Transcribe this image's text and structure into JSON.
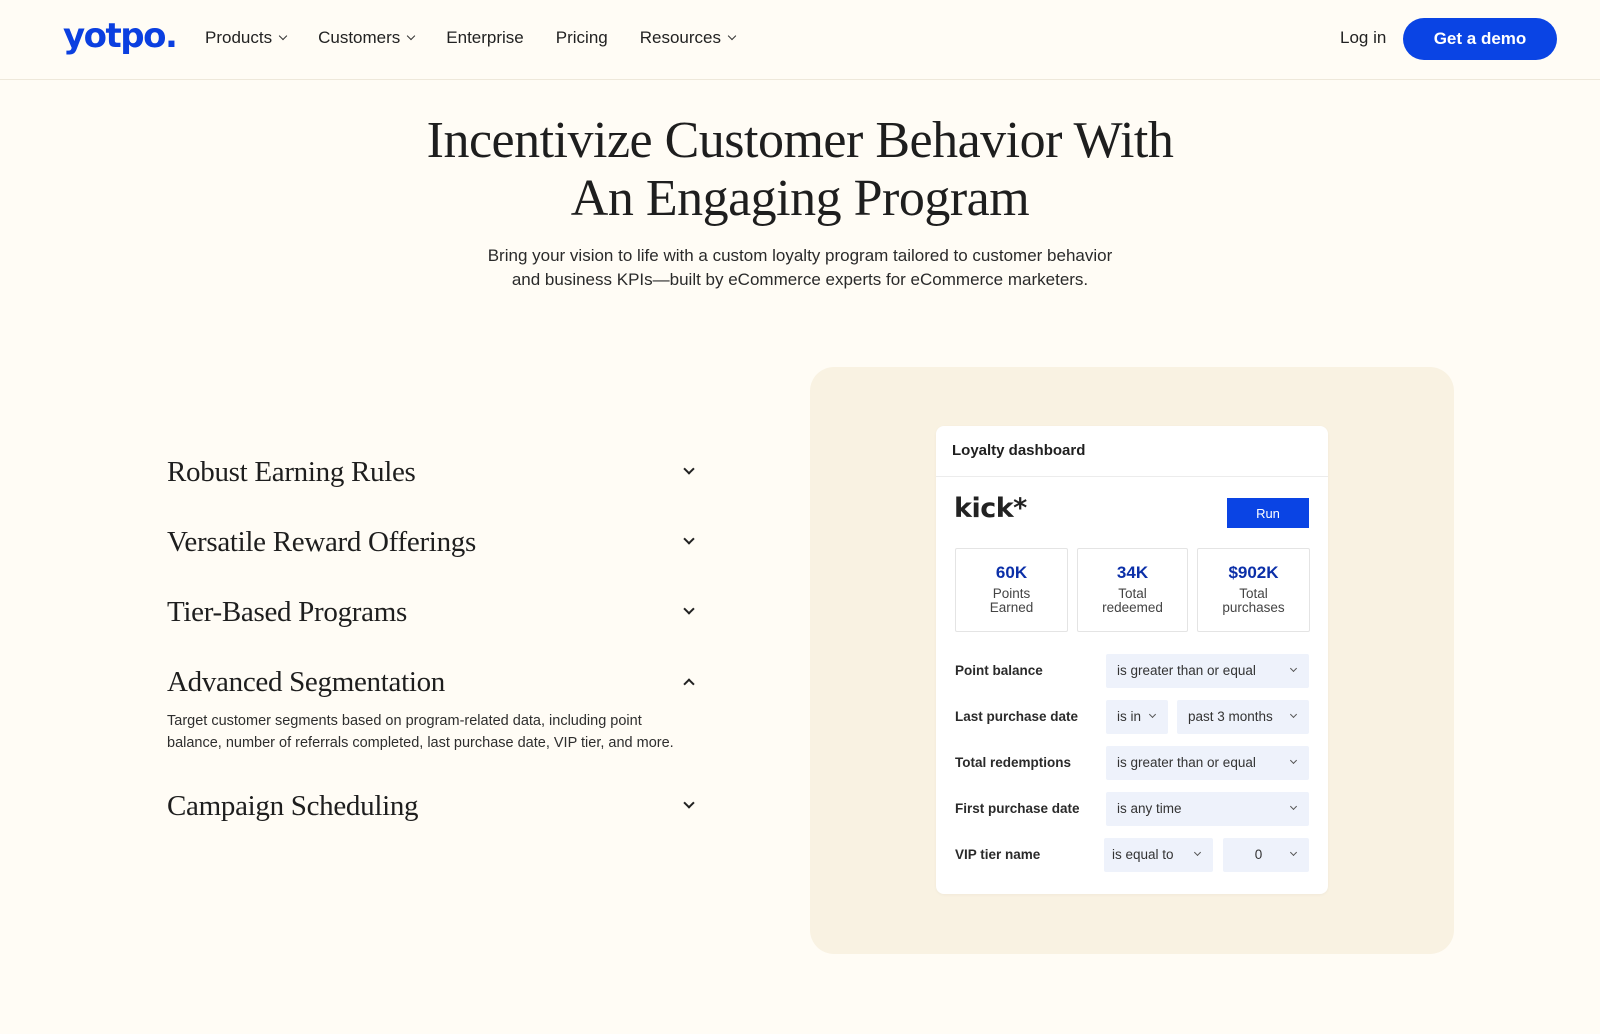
{
  "nav": {
    "logo": "yotpo.",
    "items": [
      {
        "label": "Products",
        "dropdown": true
      },
      {
        "label": "Customers",
        "dropdown": true
      },
      {
        "label": "Enterprise",
        "dropdown": false
      },
      {
        "label": "Pricing",
        "dropdown": false
      },
      {
        "label": "Resources",
        "dropdown": true
      }
    ],
    "login": "Log in",
    "cta": "Get a demo"
  },
  "hero": {
    "title_line1": "Incentivize Customer Behavior With",
    "title_line2": "An Engaging Program",
    "subtitle_line1": "Bring your vision to life with a custom loyalty program tailored to customer behavior",
    "subtitle_line2": "and business KPIs—built by eCommerce experts for eCommerce marketers."
  },
  "features": [
    {
      "title": "Robust Earning Rules",
      "expanded": false
    },
    {
      "title": "Versatile Reward Offerings",
      "expanded": false
    },
    {
      "title": "Tier-Based Programs",
      "expanded": false
    },
    {
      "title": "Advanced Segmentation",
      "expanded": true,
      "body": "Target customer segments based on program-related data, including point balance, number of referrals completed, last purchase date, VIP tier, and more."
    },
    {
      "title": "Campaign Scheduling",
      "expanded": false
    }
  ],
  "dashboard": {
    "title": "Loyalty dashboard",
    "brand": "kick*",
    "run": "Run",
    "stats": [
      {
        "value": "60K",
        "label1": "Points",
        "label2": "Earned"
      },
      {
        "value": "34K",
        "label1": "Total",
        "label2": "redeemed"
      },
      {
        "value": "$902K",
        "label1": "Total",
        "label2": "purchases"
      }
    ],
    "filters": [
      {
        "label": "Point balance",
        "op": "is greater than or equal",
        "value": ""
      },
      {
        "label": "Last purchase date",
        "op": "is in",
        "value": "past 3 months"
      },
      {
        "label": "Total redemptions",
        "op": "is greater than or equal",
        "value": ""
      },
      {
        "label": "First purchase date",
        "op": "is any time",
        "value": ""
      },
      {
        "label": "VIP tier name",
        "op": "is equal to",
        "value": "0"
      }
    ]
  },
  "colors": {
    "accent": "#0a44e4",
    "background": "#fffcf5",
    "panel": "#f9f2e2",
    "stat_value": "#0b2fa8"
  }
}
